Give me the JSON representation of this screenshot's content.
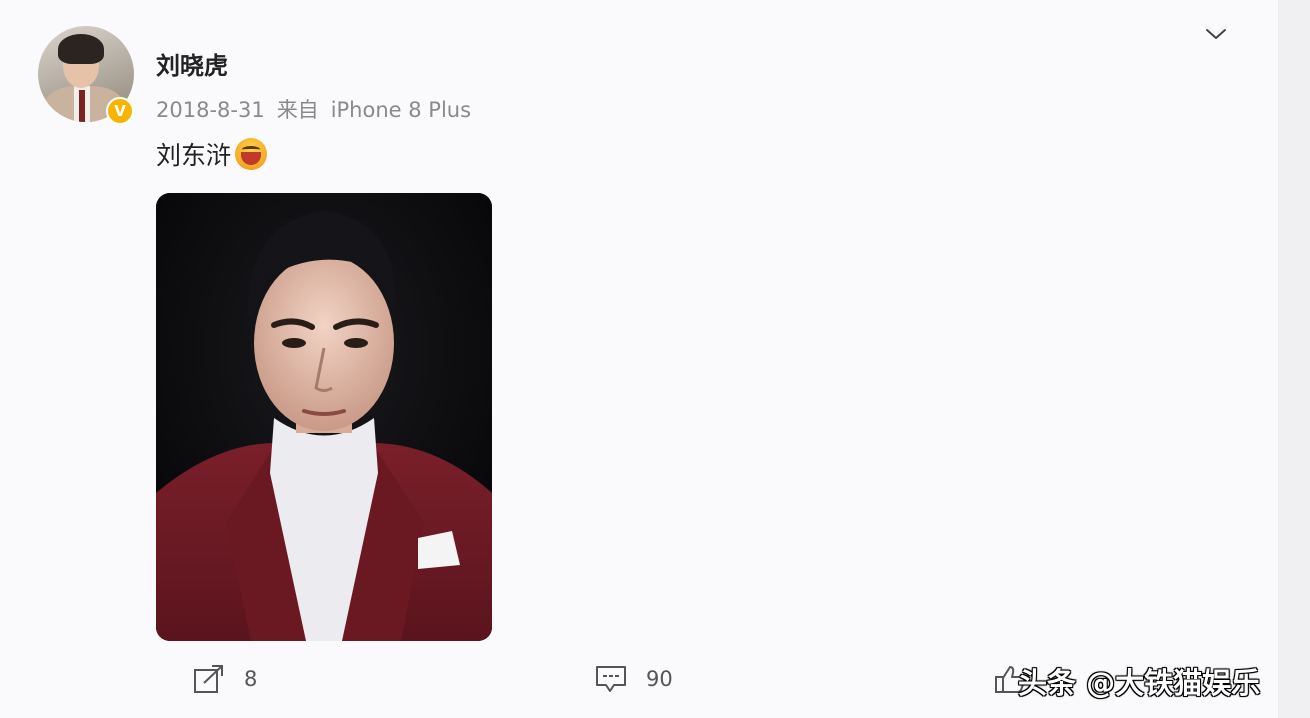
{
  "post": {
    "author": "刘晓虎",
    "date": "2018-8-31",
    "source_prefix": "来自",
    "source_device": "iPhone 8 Plus",
    "text": "刘东浒",
    "emoji": "laughing-emoji",
    "verified_badge": "V"
  },
  "actions": {
    "repost_count": "8",
    "comment_count": "90"
  },
  "watermark": "头条 @大铁猫娱乐",
  "colors": {
    "badge": "#f7b500",
    "suit": "#6e1a24",
    "background": "#fafafc"
  }
}
